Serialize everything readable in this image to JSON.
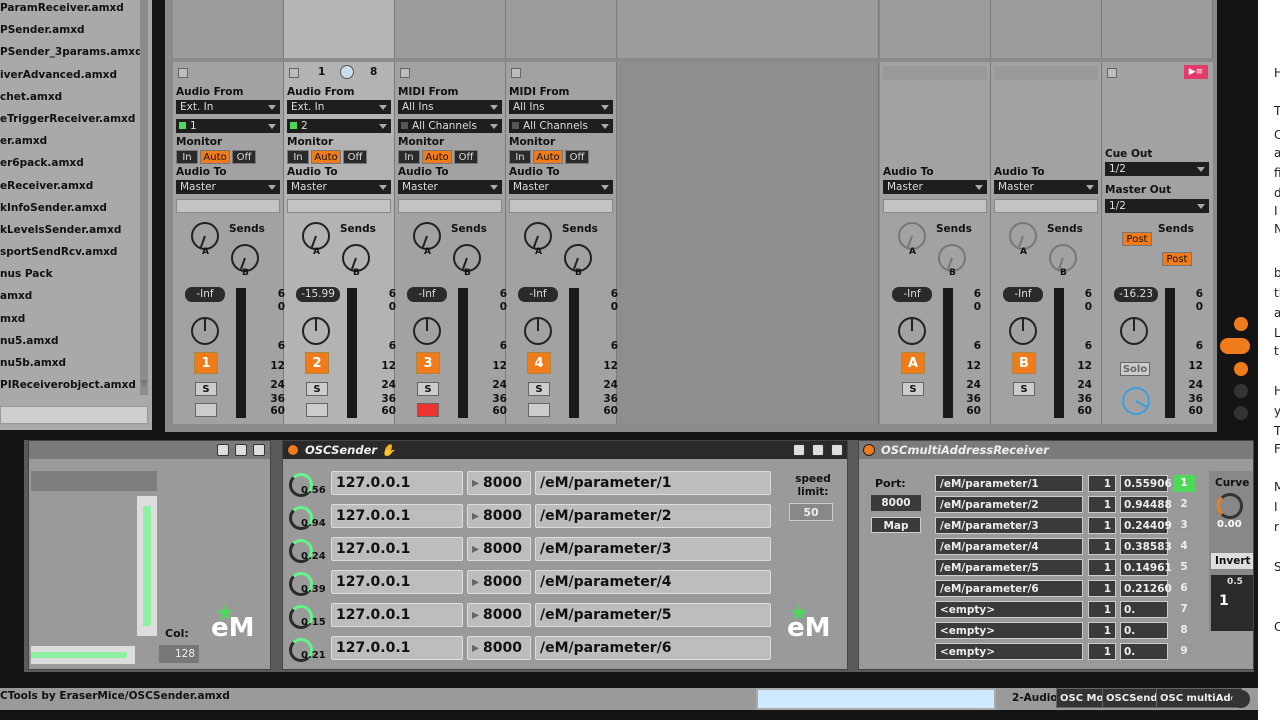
{
  "browser": {
    "items": [
      "ParamReceiver.amxd",
      "PSender.amxd",
      "PSender_3params.amxd",
      "iverAdvanced.amxd",
      "chet.amxd",
      "eTriggerReceiver.amxd",
      "er.amxd",
      "er6pack.amxd",
      "eReceiver.amxd",
      "kInfoSender.amxd",
      "kLevelsSender.amxd",
      "sportSendRcv.amxd",
      "nus Pack",
      "amxd",
      "mxd",
      "nu5.amxd",
      "nu5b.amxd",
      "PIReceiverobject.amxd"
    ]
  },
  "mixer": {
    "track1": {
      "section1": "Audio From",
      "input": "Ext. In",
      "channel": "1",
      "monitor_label": "Monitor",
      "mon_in": "In",
      "mon_auto": "Auto",
      "mon_off": "Off",
      "audio_to": "Audio To",
      "output": "Master",
      "sends": "Sends",
      "send_a": "A",
      "send_b": "B",
      "volume": "-Inf",
      "number": "1",
      "solo": "S"
    },
    "track2": {
      "section1": "Audio From",
      "input": "Ext. In",
      "channel": "2",
      "monitor_label": "Monitor",
      "mon_in": "In",
      "mon_auto": "Auto",
      "mon_off": "Off",
      "audio_to": "Audio To",
      "output": "Master",
      "sends": "Sends",
      "send_a": "A",
      "send_b": "B",
      "volume": "-15.99",
      "number": "2",
      "solo": "S",
      "pager_left": "1",
      "pager_right": "8"
    },
    "track3": {
      "section1": "MIDI From",
      "input": "All Ins",
      "channel": "All Channels",
      "monitor_label": "Monitor",
      "mon_in": "In",
      "mon_auto": "Auto",
      "mon_off": "Off",
      "audio_to": "Audio To",
      "output": "Master",
      "sends": "Sends",
      "send_a": "A",
      "send_b": "B",
      "volume": "-Inf",
      "number": "3",
      "solo": "S"
    },
    "track4": {
      "section1": "MIDI From",
      "input": "All Ins",
      "channel": "All Channels",
      "monitor_label": "Monitor",
      "mon_in": "In",
      "mon_auto": "Auto",
      "mon_off": "Off",
      "audio_to": "Audio To",
      "output": "Master",
      "sends": "Sends",
      "send_a": "A",
      "send_b": "B",
      "volume": "-Inf",
      "number": "4",
      "solo": "S"
    },
    "returnA": {
      "audio_to": "Audio To",
      "output": "Master",
      "sends": "Sends",
      "send_a": "A",
      "send_b": "B",
      "volume": "-Inf",
      "number": "A",
      "solo": "S"
    },
    "returnB": {
      "audio_to": "Audio To",
      "output": "Master",
      "sends": "Sends",
      "send_a": "A",
      "send_b": "B",
      "volume": "-Inf",
      "number": "B",
      "solo": "S"
    },
    "master": {
      "cue_out": "Cue Out",
      "cue_val": "1/2",
      "master_out": "Master Out",
      "master_val": "1/2",
      "sends": "Sends",
      "post1": "Post",
      "post2": "Post",
      "volume": "-16.23",
      "solo": "Solo"
    },
    "scale": [
      "6",
      "0",
      "6",
      "12",
      "24",
      "36",
      "60"
    ]
  },
  "colors": {
    "accent": "#f07b1a",
    "meter_green": "#62f58a",
    "active_green": "#4ed85a"
  },
  "device_left": {
    "col_label": "Col:",
    "col_value": "128",
    "logo": "eM"
  },
  "osc_sender": {
    "title": "OSCSender",
    "rows": [
      {
        "knob": "0.56",
        "ip": "127.0.0.1",
        "port": "8000",
        "address": "/eM/parameter/1"
      },
      {
        "knob": "0.94",
        "ip": "127.0.0.1",
        "port": "8000",
        "address": "/eM/parameter/2"
      },
      {
        "knob": "0.24",
        "ip": "127.0.0.1",
        "port": "8000",
        "address": "/eM/parameter/3"
      },
      {
        "knob": "0.39",
        "ip": "127.0.0.1",
        "port": "8000",
        "address": "/eM/parameter/4"
      },
      {
        "knob": "0.15",
        "ip": "127.0.0.1",
        "port": "8000",
        "address": "/eM/parameter/5"
      },
      {
        "knob": "0.21",
        "ip": "127.0.0.1",
        "port": "8000",
        "address": "/eM/parameter/6"
      }
    ],
    "speed_label": "speed\nlimit:",
    "speed_value": "50",
    "logo": "eM"
  },
  "osc_receiver": {
    "title": "OSCmultiAddressReceiver",
    "port_label": "Port:",
    "port_value": "8000",
    "map_label": "Map",
    "curve_label": "Curve",
    "curve_value": "0.00",
    "invert_label": "Invert",
    "small_value": "0.5",
    "one_value": "1",
    "rows": [
      {
        "address": "/eM/parameter/1",
        "ch": "1",
        "value": "0.55906",
        "idx": "1"
      },
      {
        "address": "/eM/parameter/2",
        "ch": "1",
        "value": "0.94488",
        "idx": "2"
      },
      {
        "address": "/eM/parameter/3",
        "ch": "1",
        "value": "0.24409",
        "idx": "3"
      },
      {
        "address": "/eM/parameter/4",
        "ch": "1",
        "value": "0.38583",
        "idx": "4"
      },
      {
        "address": "/eM/parameter/5",
        "ch": "1",
        "value": "0.14961",
        "idx": "5"
      },
      {
        "address": "/eM/parameter/6",
        "ch": "1",
        "value": "0.21260",
        "idx": "6"
      },
      {
        "address": "<empty>",
        "ch": "1",
        "value": "0.",
        "idx": "7"
      },
      {
        "address": "<empty>",
        "ch": "1",
        "value": "0.",
        "idx": "8"
      },
      {
        "address": "<empty>",
        "ch": "1",
        "value": "0.",
        "idx": "9"
      }
    ]
  },
  "status": {
    "path": "CTools by EraserMice/OSCSender.amxd",
    "track_label": "2-Audio",
    "tab1": "OSC Mon",
    "tab2": "OSCSende",
    "tab3": "OSC multiAdd"
  },
  "doc_letters": [
    "H",
    "T",
    "C",
    "a",
    "fi",
    "d",
    "I",
    "N",
    "b",
    "tl",
    "a",
    "L",
    "t",
    "H",
    "y",
    "T",
    "F",
    "M",
    "I",
    "r",
    "S",
    "C"
  ]
}
